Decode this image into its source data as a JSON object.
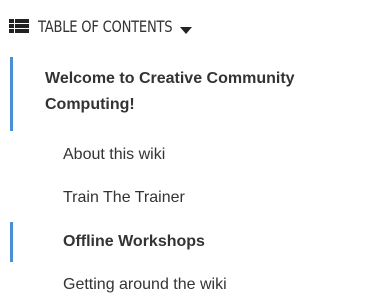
{
  "toc": {
    "header_icon": "list-icon",
    "header_title": "TABLE OF CONTENTS",
    "caret_icon": "caret-down-icon",
    "accent_color": "#4a90d9",
    "items": [
      {
        "label": "Welcome to Creative Community Computing!",
        "level": 1,
        "bold": true,
        "active": true
      },
      {
        "label": "About this wiki",
        "level": 2,
        "bold": false,
        "active": false
      },
      {
        "label": "Train The Trainer",
        "level": 2,
        "bold": false,
        "active": false
      },
      {
        "label": "Offline Workshops",
        "level": 2,
        "bold": true,
        "active": true
      },
      {
        "label": "Getting around the wiki",
        "level": 2,
        "bold": false,
        "active": false
      }
    ]
  }
}
